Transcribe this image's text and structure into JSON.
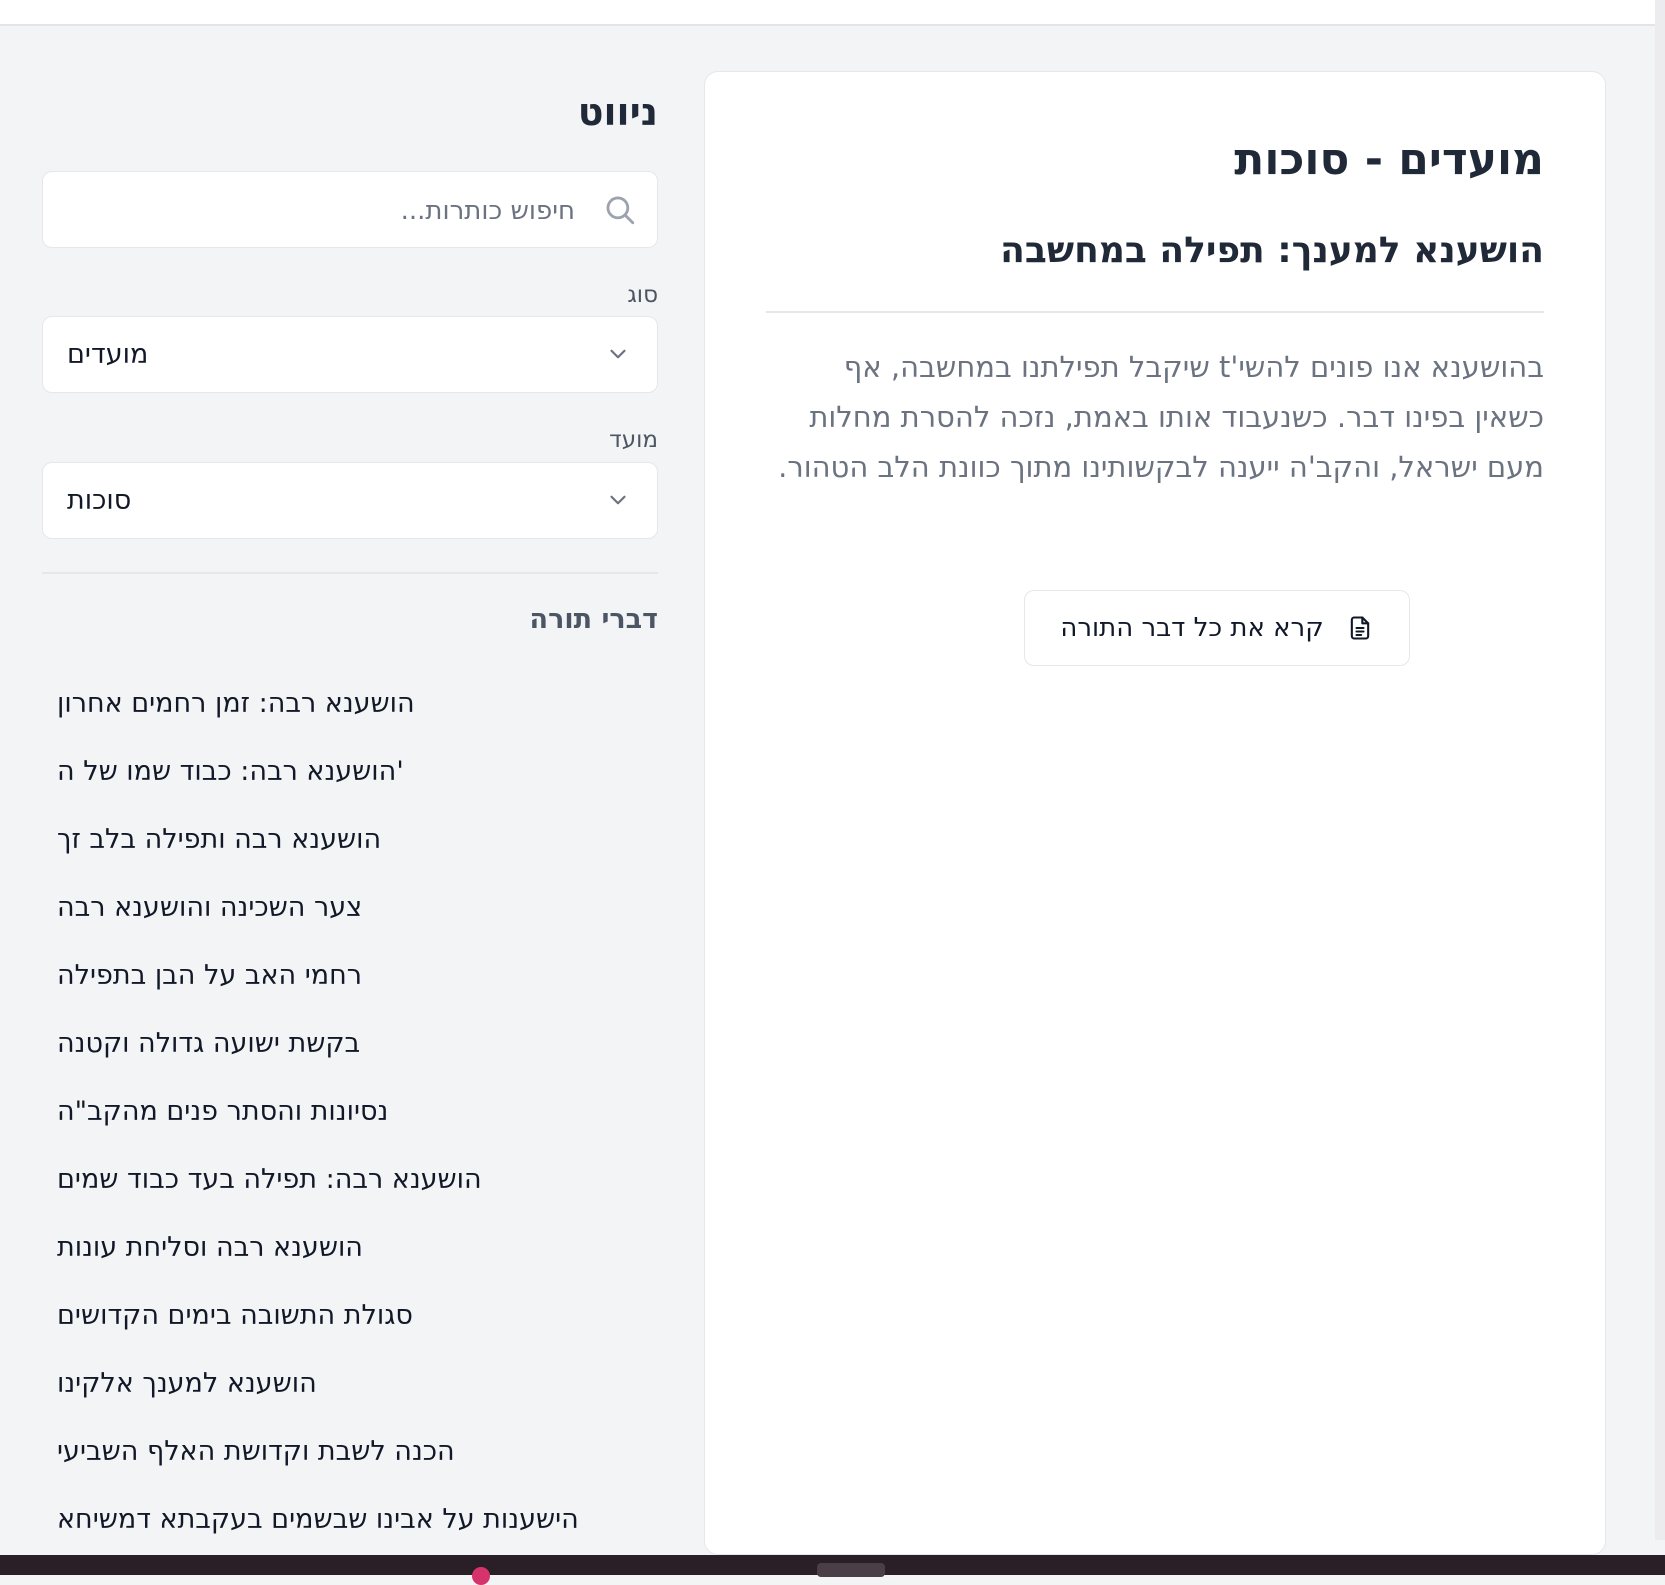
{
  "main": {
    "title": "מועדים - סוכות",
    "subtitle": "הושענא למענך: תפילה במחשבה",
    "summary": "בהושענא אנו פונים להשי't שיקבל תפילתנו במחשבה, אף כשאין בפינו דבר. כשנעבוד אותו באמת, נזכה להסרת מחלות מעם ישראל, והקב'ה ייענה לבקשותינו מתוך כוונת הלב הטהור.",
    "read_button": {
      "label": "קרא את כל דבר התורה",
      "icon": "document-icon"
    }
  },
  "sidebar": {
    "title": "ניווט",
    "search": {
      "placeholder": "חיפוש כותרות...",
      "value": "",
      "icon": "search-icon"
    },
    "type_filter": {
      "label": "סוג",
      "value": "מועדים"
    },
    "holiday_filter": {
      "label": "מועד",
      "value": "סוכות"
    },
    "section_label": "דברי תורה",
    "items": [
      "הושענא רבה: זמן רחמים אחרון",
      "הושענא רבה: כבוד שמו של ה'",
      "הושענא רבה ותפילה בלב זך",
      "צער השכינה והושענא רבה",
      "רחמי האב על הבן בתפילה",
      "בקשת ישועה גדולה וקטנה",
      "נסיונות והסתר פנים מהקב\"ה",
      "הושענא רבה: תפילה בעד כבוד שמים",
      "הושענא רבה וסליחת עונות",
      "סגולת התשובה בימים הקדושים",
      "הושענא למענך אלקינו",
      "הכנה לשבת וקדושת האלף השביעי",
      "הישענות על אבינו שבשמים בעקבתא דמשיחא"
    ]
  },
  "colors": {
    "background": "#f3f4f6",
    "card": "#ffffff",
    "heading": "#1f2937",
    "muted_text": "#6b7280",
    "border": "#e5e7eb"
  }
}
